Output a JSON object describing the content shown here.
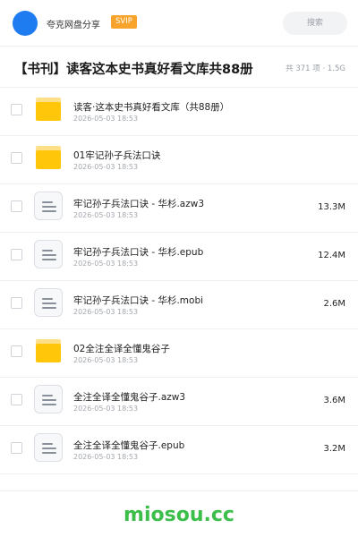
{
  "header": {
    "app_name": "夸克网盘分享",
    "badge": "SVIP",
    "search_placeholder": "搜索"
  },
  "folder": {
    "title": "【书刊】读客这本史书真好看文库共88册",
    "meta": "共 371 项 · 1.5G"
  },
  "files": [
    {
      "type": "folder",
      "name": "读客·这本史书真好看文库（共88册）",
      "date": "2026-05-03 18:53",
      "size": ""
    },
    {
      "type": "folder",
      "name": "01牢记孙子兵法口诀",
      "date": "2026-05-03 18:53",
      "size": ""
    },
    {
      "type": "file",
      "name": "牢记孙子兵法口诀 - 华杉.azw3",
      "date": "2026-05-03 18:53",
      "size": "13.3M"
    },
    {
      "type": "file",
      "name": "牢记孙子兵法口诀 - 华杉.epub",
      "date": "2026-05-03 18:53",
      "size": "12.4M"
    },
    {
      "type": "file",
      "name": "牢记孙子兵法口诀 - 华杉.mobi",
      "date": "2026-05-03 18:53",
      "size": "2.6M"
    },
    {
      "type": "folder",
      "name": "02全注全译全懂鬼谷子",
      "date": "2026-05-03 18:53",
      "size": ""
    },
    {
      "type": "file",
      "name": "全注全译全懂鬼谷子.azw3",
      "date": "2026-05-03 18:53",
      "size": "3.6M"
    },
    {
      "type": "file",
      "name": "全注全译全懂鬼谷子.epub",
      "date": "2026-05-03 18:53",
      "size": "3.2M"
    }
  ],
  "footer": {
    "watermark": "miosou.cc"
  },
  "colors": {
    "avatar": "#1e7cf0",
    "badge": "#f7a32c",
    "folder": "#ffc60a",
    "watermark": "#3cbf4a"
  }
}
